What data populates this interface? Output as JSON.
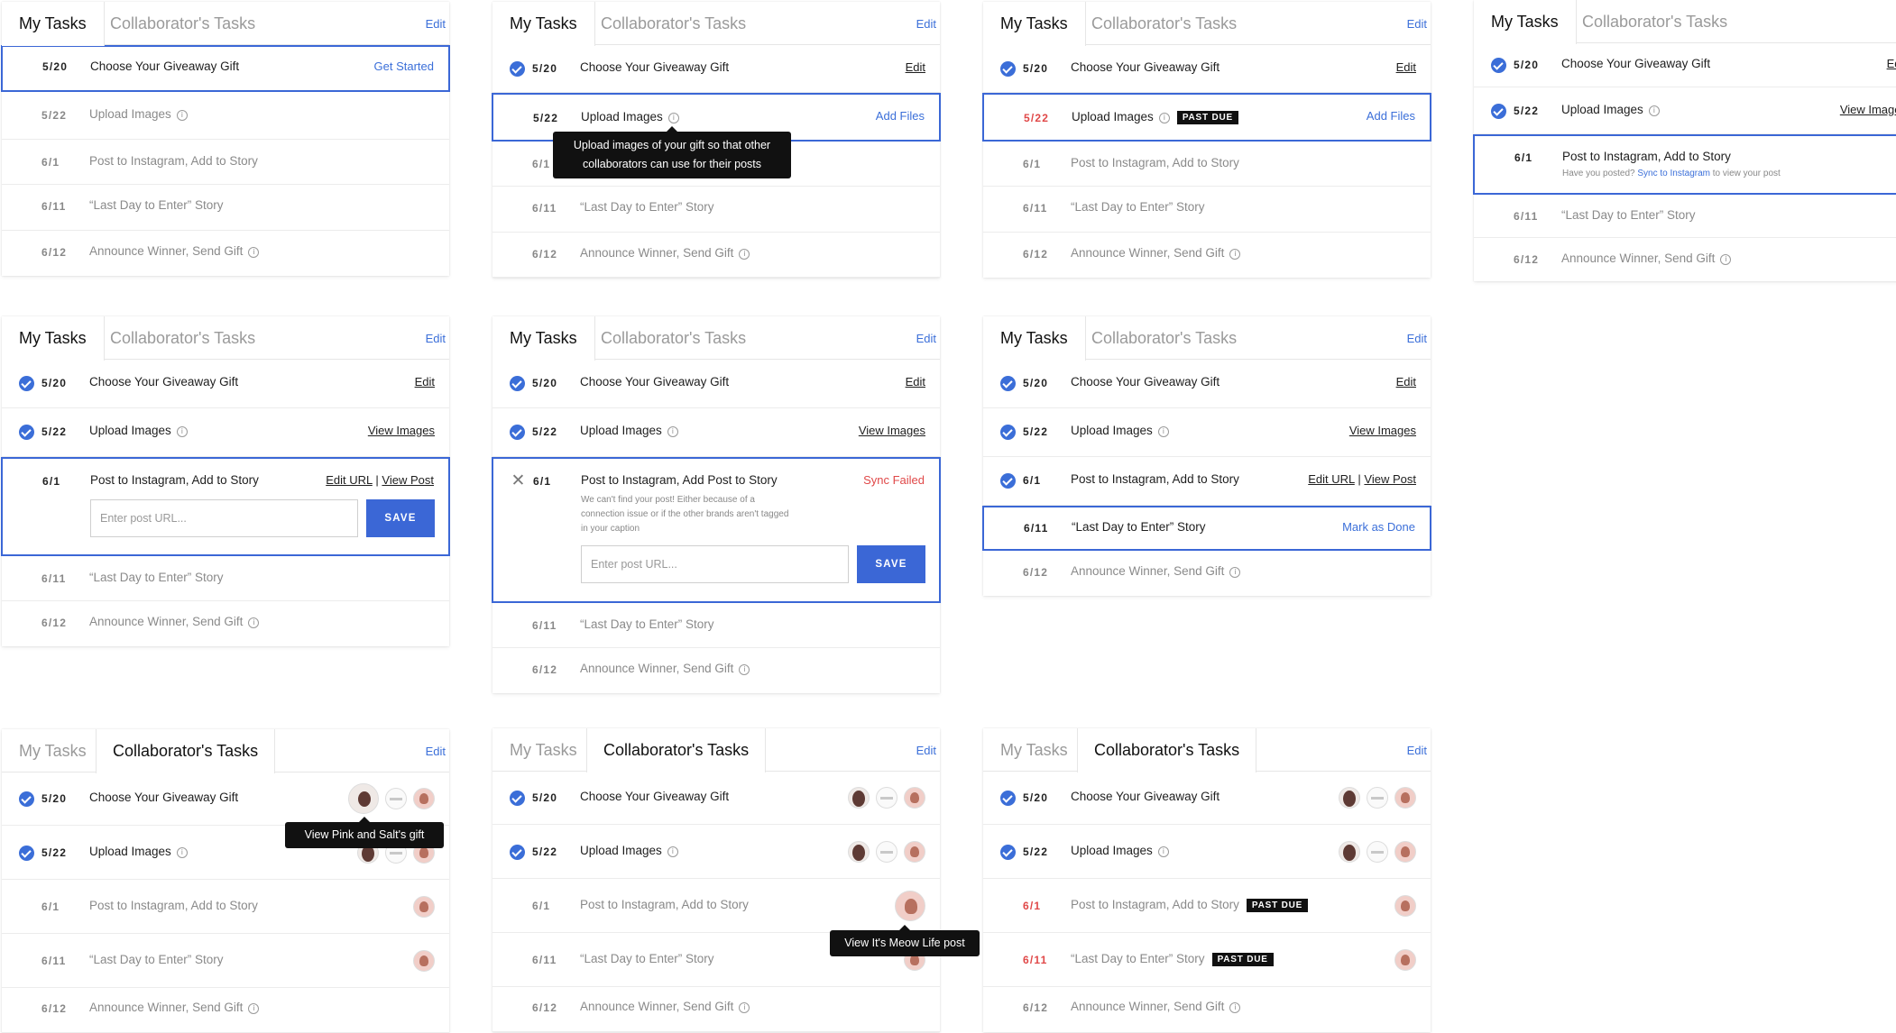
{
  "colors": {
    "accent": "#3b67d6",
    "danger": "#e04848",
    "badge": "#111111"
  },
  "icons": {
    "check": "check-circle-icon",
    "info": "info-icon",
    "close": "x-icon",
    "avatar": "brand-avatar"
  },
  "tabs": {
    "my": "My Tasks",
    "collab": "Collaborator's Tasks"
  },
  "edit_label": "Edit",
  "tasks": {
    "t1": "Choose Your Giveaway Gift",
    "t2": "Upload Images",
    "t3": "Post to Instagram, Add to Story",
    "t3b": "Post to Instagram, Add Post to Story",
    "t4": "“Last Day to Enter” Story",
    "t5": "Announce Winner, Send Gift"
  },
  "dates": {
    "d1": "5/20",
    "d2": "5/22",
    "d3": "6/1",
    "d4": "6/11",
    "d5": "6/12"
  },
  "actions": {
    "get_started": "Get Started",
    "edit": "Edit",
    "add_files": "Add Files",
    "view_images": "View Images",
    "edit_url": "Edit URL",
    "sep": "|",
    "view_post": "View Post",
    "sync_failed": "Sync Failed",
    "mark_done": "Mark as Done",
    "save": "SAVE"
  },
  "badge": "PAST DUE",
  "info_glyph": "i",
  "close_glyph": "✕",
  "input_placeholder": "Enter post URL...",
  "tooltips": {
    "upload": "Upload images of your gift so that other collaborators can use for their posts",
    "view_gift": "View Pink and Salt's gift",
    "view_post": "View It's Meow Life post"
  },
  "posted_prompt": {
    "before": "Have you posted? ",
    "link": "Sync to Instagram",
    "after": " to view your post"
  },
  "sync_error": "We can't find your post! Either because of a connection issue or if the other brands aren't tagged in your caption"
}
